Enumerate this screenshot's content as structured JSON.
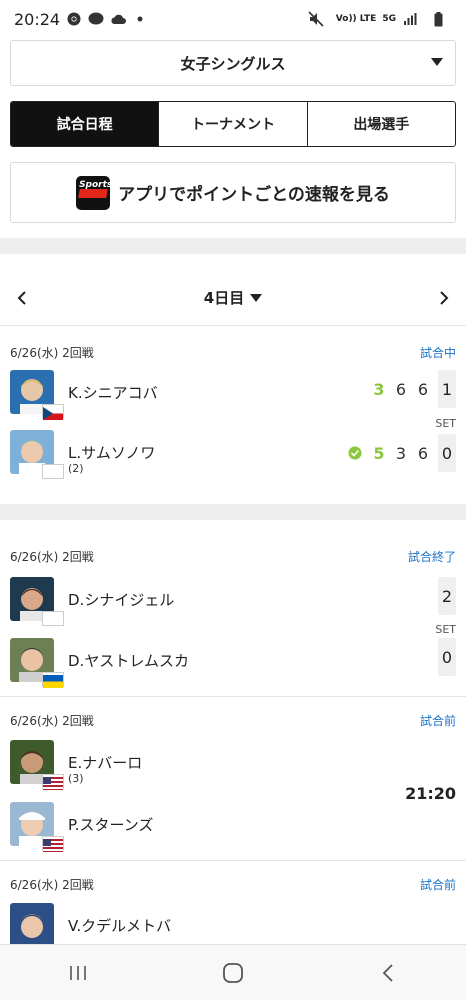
{
  "status_bar": {
    "time": "20:24",
    "network_left": "Vo)) LTE",
    "network_right": "5G"
  },
  "dropdown": {
    "label": "女子シングルス"
  },
  "tabs": [
    {
      "label": "試合日程",
      "active": true
    },
    {
      "label": "トーナメント",
      "active": false
    },
    {
      "label": "出場選手",
      "active": false
    }
  ],
  "app_banner": {
    "label": "アプリでポイントごとの速報を見る",
    "logo_text": "Sports"
  },
  "day_nav": {
    "label": "4日目"
  },
  "matches": [
    {
      "date_round": "6/26(水) 2回戦",
      "status": "試合中",
      "set_label": "SET",
      "players": [
        {
          "name": "K.シニアコバ",
          "seed": "",
          "flag": "CZE",
          "sets": [
            "3",
            "6",
            "6"
          ],
          "set_total": "1",
          "serving": false
        },
        {
          "name": "L.サムソノワ",
          "seed": "(2)",
          "flag": "",
          "sets": [
            "5",
            "3",
            "6"
          ],
          "set_total": "0",
          "serving": true
        }
      ]
    },
    {
      "date_round": "6/26(水) 2回戦",
      "status": "試合終了",
      "set_label": "SET",
      "players": [
        {
          "name": "D.シナイジェル",
          "seed": "",
          "flag": "",
          "set_total": "2"
        },
        {
          "name": "D.ヤストレムスカ",
          "seed": "",
          "flag": "UKR",
          "set_total": "0"
        }
      ]
    },
    {
      "date_round": "6/26(水) 2回戦",
      "status": "試合前",
      "start_time": "21:20",
      "players": [
        {
          "name": "E.ナバーロ",
          "seed": "(3)",
          "flag": "USA"
        },
        {
          "name": "P.スターンズ",
          "seed": "",
          "flag": "USA"
        }
      ]
    },
    {
      "date_round": "6/26(水) 2回戦",
      "status": "試合前",
      "players": [
        {
          "name": "V.クデルメトバ",
          "seed": "",
          "flag": ""
        }
      ]
    }
  ],
  "colors": {
    "accent_blue": "#1a73c9",
    "score_green": "#8cc63f",
    "active_tab": "#111111"
  }
}
